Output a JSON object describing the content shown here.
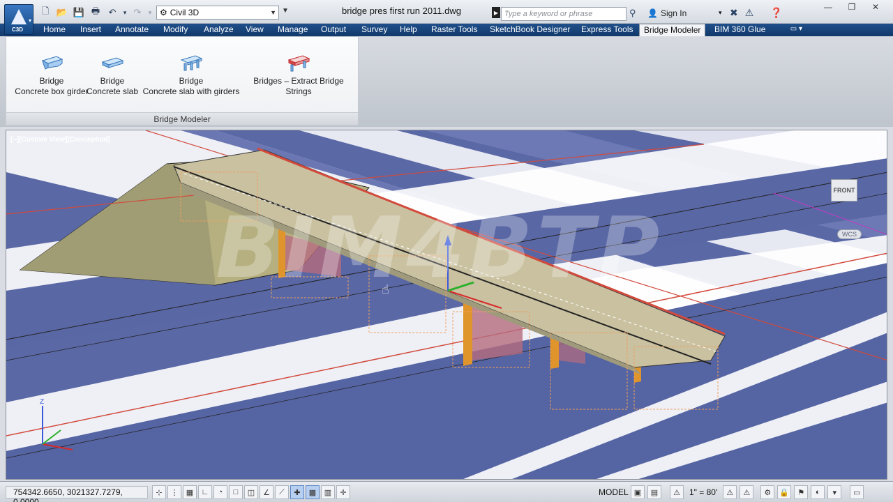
{
  "app": {
    "badge": "C3D"
  },
  "workspace": {
    "value": "Civil 3D"
  },
  "document": {
    "title": "bridge pres first run 2011.dwg"
  },
  "search": {
    "placeholder": "Type a keyword or phrase"
  },
  "account": {
    "sign_in": "Sign In"
  },
  "tabs": [
    "Home",
    "Insert",
    "Annotate",
    "Modify",
    "Analyze",
    "View",
    "Manage",
    "Output",
    "Survey",
    "Help",
    "Raster Tools",
    "SketchBook Designer",
    "Express Tools",
    "Bridge Modeler",
    "BIM 360 Glue"
  ],
  "active_tab": "Bridge Modeler",
  "ribbon": {
    "panel_title": "Bridge Modeler",
    "buttons": [
      {
        "line1": "Bridge",
        "line2": "Concrete box girder",
        "icon": "box-girder-icon"
      },
      {
        "line1": "Bridge",
        "line2": "Concrete slab",
        "icon": "concrete-slab-icon"
      },
      {
        "line1": "Bridge",
        "line2": "Concrete slab with girders",
        "icon": "slab-girders-icon"
      },
      {
        "line1": "Bridges – Extract Bridge Strings",
        "line2": "",
        "icon": "extract-strings-icon"
      }
    ]
  },
  "viewport": {
    "label": "[–][Custom View][Conceptual]",
    "viewcube_face": "FRONT",
    "wcs": "WCS",
    "watermark": "BIM4BTP"
  },
  "statusbar": {
    "coordinates": "754342.6650, 3021327.7279, 0.0000",
    "model": "MODEL",
    "scale": "1\" = 80'"
  },
  "colors": {
    "ribbon_tab_bar": "#1f4f8a",
    "viewport_bg": "#5c6aa8",
    "bridge_deck": "#c9c1a0",
    "pier": "#e0942c",
    "road_edge": "#d24a3c"
  }
}
